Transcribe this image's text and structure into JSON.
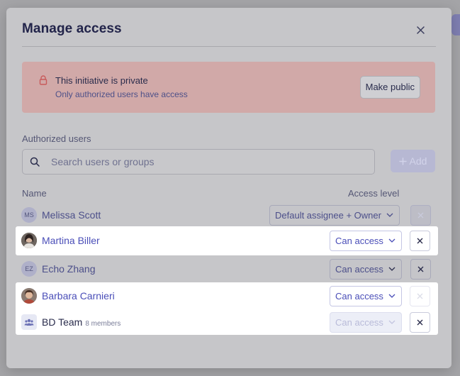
{
  "modal": {
    "title": "Manage access",
    "close_label": "close"
  },
  "banner": {
    "title": "This initiative is private",
    "subtitle": "Only authorized users have access",
    "make_public_label": "Make public"
  },
  "authorized": {
    "section_label": "Authorized users",
    "search_placeholder": "Search users or groups",
    "search_value": "",
    "add_label": "Add"
  },
  "table": {
    "col_name": "Name",
    "col_access": "Access level",
    "rows": [
      {
        "initials": "MS",
        "name": "Melissa Scott",
        "access": "Default assignee + Owner"
      },
      {
        "initials": "",
        "name": "Martina Biller",
        "access": "Can access"
      },
      {
        "initials": "EZ",
        "name": "Echo Zhang",
        "access": "Can access"
      },
      {
        "initials": "",
        "name": "Barbara Carnieri",
        "access": "Can access"
      },
      {
        "initials": "",
        "name": "BD Team",
        "members": "8 members",
        "access": "Can access"
      }
    ]
  },
  "colors": {
    "accent": "#4a4eb8",
    "danger_banner": "#d1a9a8",
    "title": "#22244a"
  },
  "icons": {
    "banner": "lock-icon",
    "search": "search-icon",
    "close": "close-icon",
    "chevron": "chevron-down-icon",
    "group": "group-icon"
  }
}
